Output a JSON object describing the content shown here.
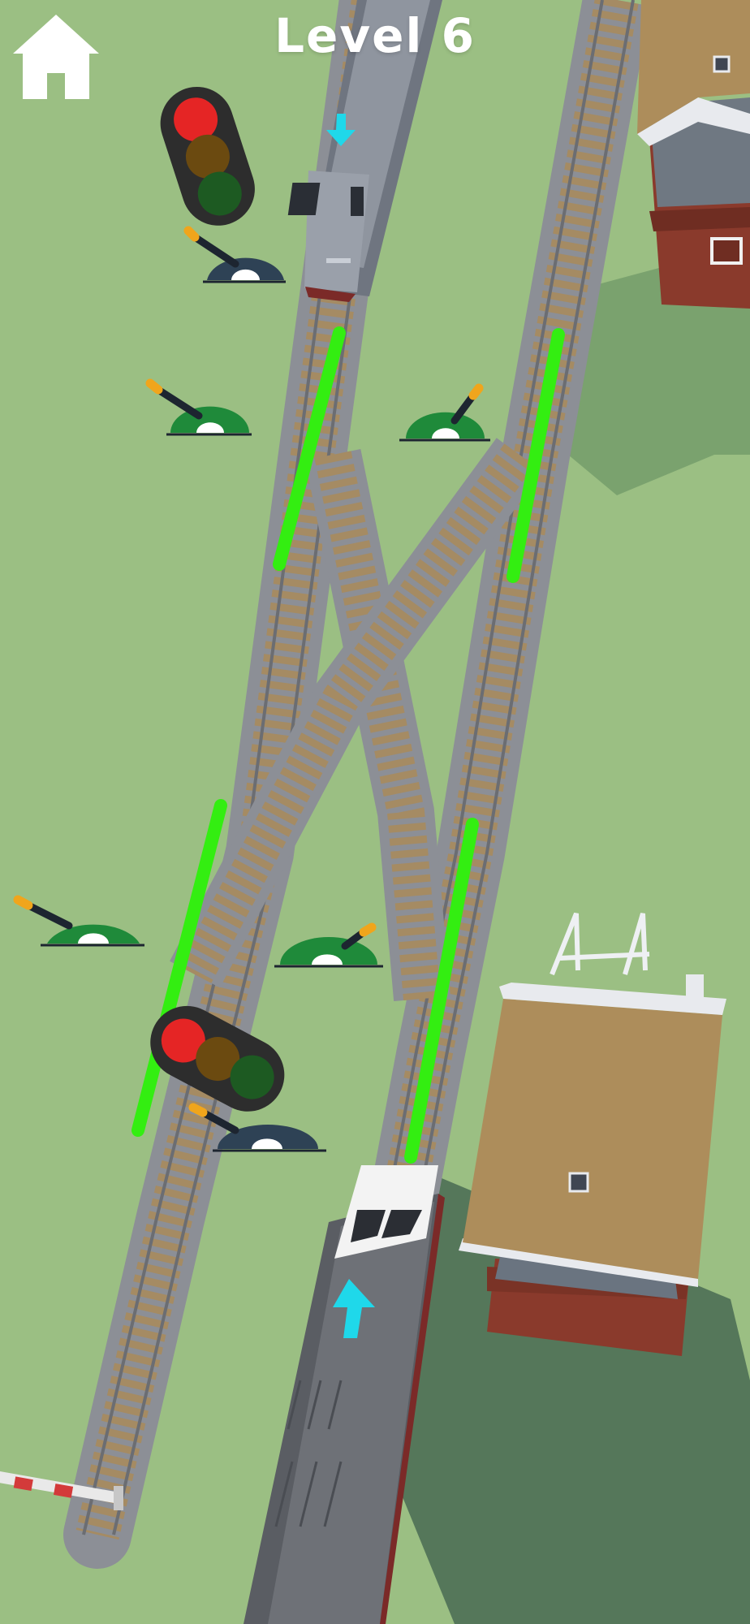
{
  "hud": {
    "level_label": "Level 6",
    "home_icon": "home-icon"
  },
  "colors": {
    "grass": "#9bbf83",
    "rail_bed": "#8c8f96",
    "ties": "#a58b63",
    "switch_line": "#33ee11",
    "arrow": "#1fd8ea",
    "lever_active": "#1f8a3a",
    "lever_inactive": "#2e4255",
    "signal_red": "#e52525",
    "signal_amber_off": "#6b4a10",
    "signal_green_off": "#1d5a22"
  },
  "signals": [
    {
      "name": "traffic-light-top",
      "state": "red"
    },
    {
      "name": "traffic-light-bottom",
      "state": "red"
    }
  ],
  "levers": [
    {
      "name": "switch-lever-1",
      "state": "inactive"
    },
    {
      "name": "switch-lever-2",
      "state": "active"
    },
    {
      "name": "switch-lever-3",
      "state": "active"
    },
    {
      "name": "switch-lever-4",
      "state": "active"
    },
    {
      "name": "switch-lever-5",
      "state": "active"
    },
    {
      "name": "switch-lever-6",
      "state": "inactive"
    }
  ],
  "trains": [
    {
      "name": "train-incoming-top",
      "direction": "down"
    },
    {
      "name": "train-player-bottom",
      "direction": "up"
    }
  ]
}
